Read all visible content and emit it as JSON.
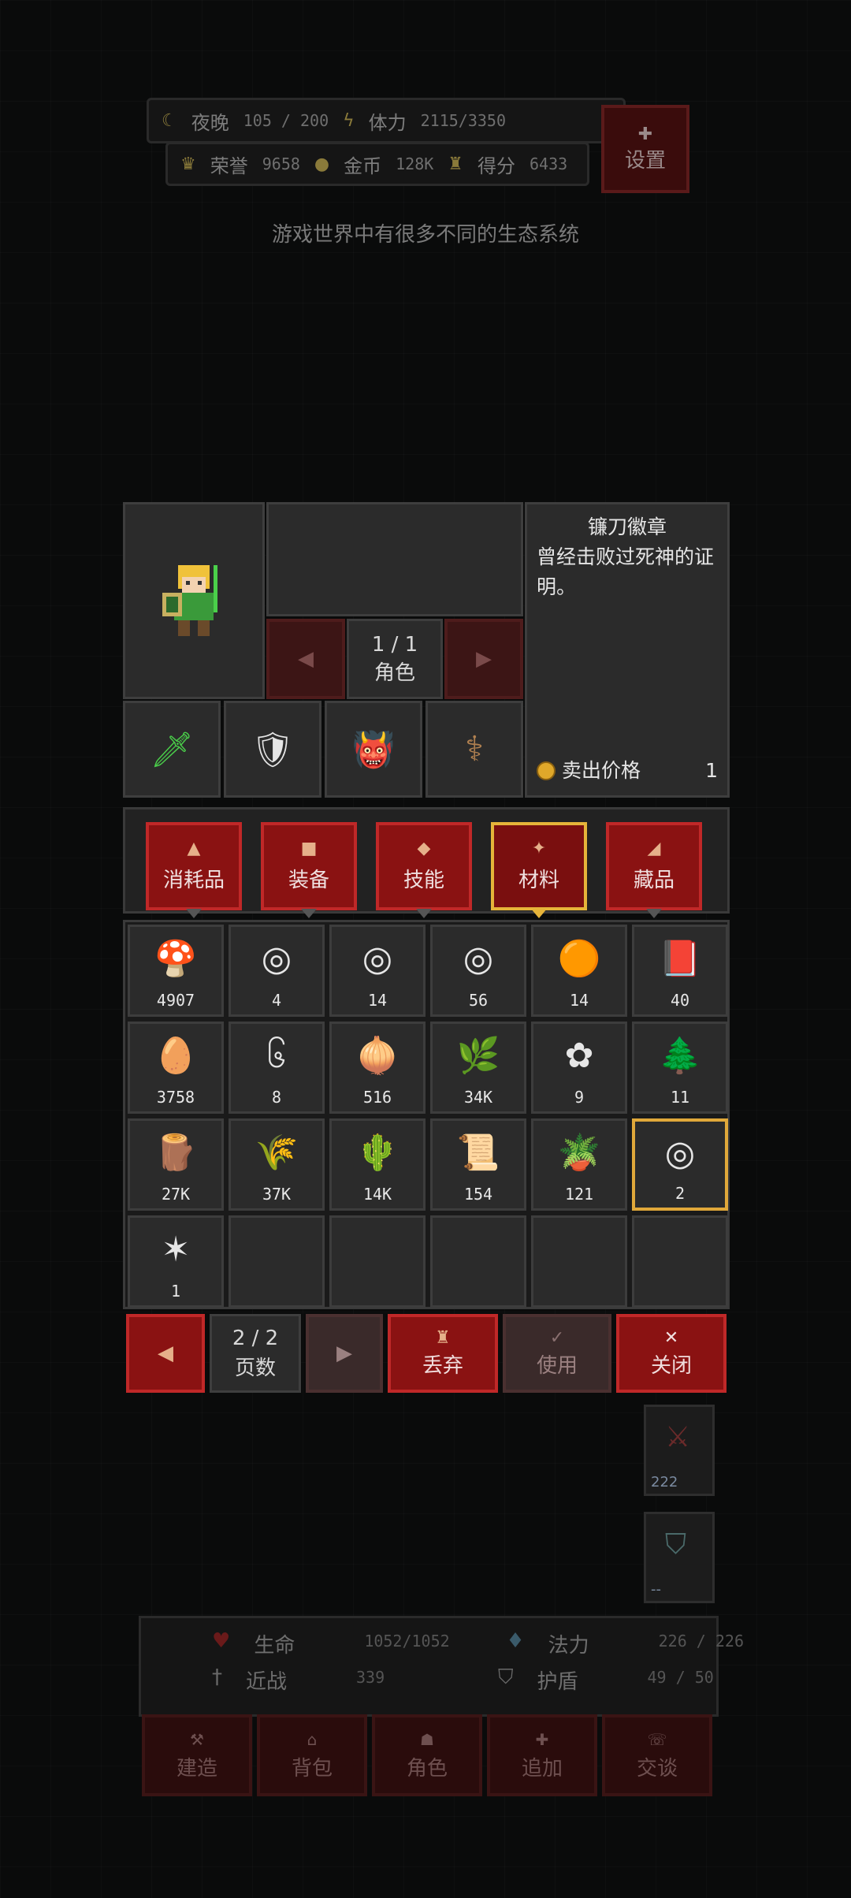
{
  "hud": {
    "night_label": "夜晚",
    "night_value": "105 / 200",
    "stamina_label": "体力",
    "stamina_value": "2115/3350",
    "honor_label": "荣誉",
    "honor_value": "9658",
    "gold_label": "金币",
    "gold_value": "128K",
    "score_label": "得分",
    "score_value": "6433",
    "settings_label": "设置"
  },
  "tip_text": "游戏世界中有很多不同的生态系统",
  "character": {
    "page": "1 / 1",
    "page_label": "角色",
    "equipment": [
      {
        "name": "green-sword-icon",
        "glyph": "🗡"
      },
      {
        "name": "armor-icon",
        "glyph": "🛡"
      },
      {
        "name": "goblin-cloak-icon",
        "glyph": "👹"
      },
      {
        "name": "scythe-icon",
        "glyph": "⚕"
      }
    ]
  },
  "item_detail": {
    "title": "镰刀徽章",
    "description": "曾经击败过死神的证明。",
    "sell_label": "卖出价格",
    "sell_value": "1"
  },
  "tabs": [
    {
      "label": "消耗品",
      "icon": "▲",
      "active": false
    },
    {
      "label": "装备",
      "icon": "■",
      "active": false
    },
    {
      "label": "技能",
      "icon": "◆",
      "active": false
    },
    {
      "label": "材料",
      "icon": "✦",
      "active": true
    },
    {
      "label": "藏品",
      "icon": "◢",
      "active": false
    }
  ],
  "items": [
    {
      "name": "mushroom",
      "glyph": "🍄",
      "count": "4907"
    },
    {
      "name": "orange-badge",
      "glyph": "◎",
      "count": "4"
    },
    {
      "name": "orange-badge-2",
      "glyph": "◎",
      "count": "14"
    },
    {
      "name": "orange-badge-3",
      "glyph": "◎",
      "count": "56"
    },
    {
      "name": "amber",
      "glyph": "🟠",
      "count": "14"
    },
    {
      "name": "red-book",
      "glyph": "📕",
      "count": "40"
    },
    {
      "name": "egg",
      "glyph": "🥚",
      "count": "3758"
    },
    {
      "name": "spiral",
      "glyph": "၆",
      "count": "8"
    },
    {
      "name": "onion",
      "glyph": "🧅",
      "count": "516"
    },
    {
      "name": "herb",
      "glyph": "🌿",
      "count": "34K"
    },
    {
      "name": "flower",
      "glyph": "✿",
      "count": "9"
    },
    {
      "name": "pine-tree",
      "glyph": "🌲",
      "count": "11"
    },
    {
      "name": "log",
      "glyph": "🪵",
      "count": "27K"
    },
    {
      "name": "wheat",
      "glyph": "🌾",
      "count": "37K"
    },
    {
      "name": "cactus",
      "glyph": "🌵",
      "count": "14K"
    },
    {
      "name": "scroll",
      "glyph": "📜",
      "count": "154"
    },
    {
      "name": "clay-pot",
      "glyph": "🪴",
      "count": "121"
    },
    {
      "name": "scythe-badge",
      "glyph": "◎",
      "count": "2",
      "selected": true
    },
    {
      "name": "leather",
      "glyph": "✶",
      "count": "1"
    }
  ],
  "bottom": {
    "page": "2 / 2",
    "page_label": "页数",
    "discard_label": "丢弃",
    "use_label": "使用",
    "close_label": "关闭"
  },
  "skills": [
    {
      "count": "222"
    },
    {
      "count": "--"
    }
  ],
  "stats": {
    "hp_label": "生命",
    "hp_value": "1052/1052",
    "mp_label": "法力",
    "mp_value": "226 / 226",
    "melee_label": "近战",
    "melee_value": "339",
    "shield_label": "护盾",
    "shield_value": "49 / 50"
  },
  "menu": [
    "建造",
    "背包",
    "角色",
    "追加",
    "交谈"
  ]
}
